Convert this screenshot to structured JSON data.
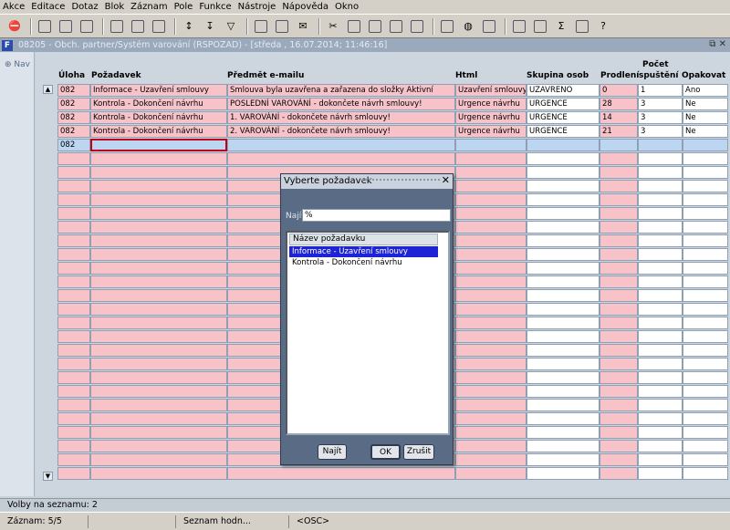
{
  "menu": [
    "Akce",
    "Editace",
    "Dotaz",
    "Blok",
    "Záznam",
    "Pole",
    "Funkce",
    "Nástroje",
    "Nápověda",
    "Okno"
  ],
  "toolbar_icons": [
    "exit-icon",
    "save-icon",
    "print-icon",
    "close-icon",
    "query-icon",
    "execute-query-icon",
    "cancel-query-icon",
    "sort-icon",
    "sort-desc-icon",
    "filter-icon",
    "print2-icon",
    "preview-icon",
    "mail-icon",
    "cut-icon",
    "copy-icon",
    "paste-icon",
    "calendar-icon",
    "attach-icon",
    "report-icon",
    "globe-icon",
    "bookmark-icon",
    "export-icon",
    "excel-icon",
    "sum-icon",
    "grid-icon",
    "help-icon"
  ],
  "window_title": "08205 - Obch. partner/Systém varování (RSPOZAD) - [středa , 16.07.2014; 11:46:16]",
  "nav_label": "Nav",
  "columns": {
    "uloha": "Úloha",
    "pozadavek": "Požadavek",
    "predmet": "Předmět e-mailu",
    "html": "Html",
    "skupina": "Skupina osob",
    "prodleni": "Prodlení",
    "pocet1": "Počet",
    "pocet2": "spuštění",
    "opakovat": "Opakovat"
  },
  "rows": [
    {
      "uloha": "082",
      "pozadavek": "Informace - Uzavření smlouvy",
      "predmet": "Smlouva byla uzavřena a zařazena do složky Aktivní",
      "html": "Uzavření smlouvy",
      "skupina": "UZAVRENO",
      "prodleni": "0",
      "pocet": "1",
      "opakovat": "Ano"
    },
    {
      "uloha": "082",
      "pozadavek": "Kontrola - Dokončení návrhu",
      "predmet": "POSLEDNÍ VAROVÁNÍ - dokončete návrh smlouvy!",
      "html": "Urgence návrhu",
      "skupina": "URGENCE",
      "prodleni": "28",
      "pocet": "3",
      "opakovat": "Ne"
    },
    {
      "uloha": "082",
      "pozadavek": "Kontrola - Dokončení návrhu",
      "predmet": "1. VAROVÁNÍ - dokončete návrh smlouvy!",
      "html": "Urgence návrhu",
      "skupina": "URGENCE",
      "prodleni": "14",
      "pocet": "3",
      "opakovat": "Ne"
    },
    {
      "uloha": "082",
      "pozadavek": "Kontrola - Dokončení návrhu",
      "predmet": "2. VAROVÁNÍ - dokončete návrh smlouvy!",
      "html": "Urgence návrhu",
      "skupina": "URGENCE",
      "prodleni": "21",
      "pocet": "3",
      "opakovat": "Ne"
    },
    {
      "uloha": "082",
      "pozadavek": "",
      "predmet": "",
      "html": "",
      "skupina": "",
      "prodleni": "",
      "pocet": "",
      "opakovat": ""
    }
  ],
  "dialog": {
    "title": "Vyberte požadavek",
    "find_label": "Najít",
    "find_value": "%",
    "list_header": "Název požadavku",
    "items": [
      "Informace - Uzavření smlouvy",
      "Kontrola - Dokončení návrhu"
    ],
    "selected_index": 0,
    "btn_find": "Najít",
    "btn_ok": "OK",
    "btn_cancel": "Zrušit"
  },
  "status": {
    "line1": "Volby na seznamu: 2",
    "record": "Záznam: 5/5",
    "seg2": "",
    "seg3": "Seznam hodn...",
    "seg4": "<OSC>"
  },
  "colors": {
    "required_field": "#f7c2c8",
    "current_row": "#bcd6f2",
    "focus_border": "#c0001a",
    "list_selection": "#1e24d6"
  }
}
